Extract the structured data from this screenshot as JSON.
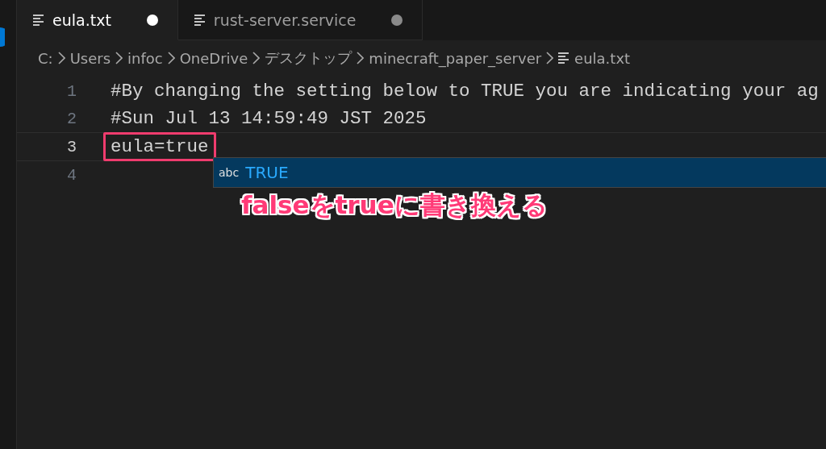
{
  "tabs": [
    {
      "label": "eula.txt",
      "selected": true,
      "modified": true
    },
    {
      "label": "rust-server.service",
      "selected": false,
      "modified": true
    }
  ],
  "breadcrumbs": [
    {
      "label": "C:",
      "kind": "folder"
    },
    {
      "label": "Users",
      "kind": "folder"
    },
    {
      "label": "infoc",
      "kind": "folder"
    },
    {
      "label": "OneDrive",
      "kind": "folder"
    },
    {
      "label": "デスクトップ",
      "kind": "folder"
    },
    {
      "label": "minecraft_paper_server",
      "kind": "folder"
    },
    {
      "label": "eula.txt",
      "kind": "file"
    }
  ],
  "lines": [
    {
      "number": "1",
      "text": "#By changing the setting below to TRUE you are indicating your ag",
      "current": false,
      "highlighted": false
    },
    {
      "number": "2",
      "text": "#Sun Jul 13 14:59:49 JST 2025",
      "current": false,
      "highlighted": false
    },
    {
      "number": "3",
      "text": "eula=true",
      "current": true,
      "highlighted": true
    },
    {
      "number": "4",
      "current": false
    }
  ],
  "suggestion": {
    "icon_text": "abc",
    "label": "TRUE"
  },
  "annotation": "falseをtrueに書き換える"
}
